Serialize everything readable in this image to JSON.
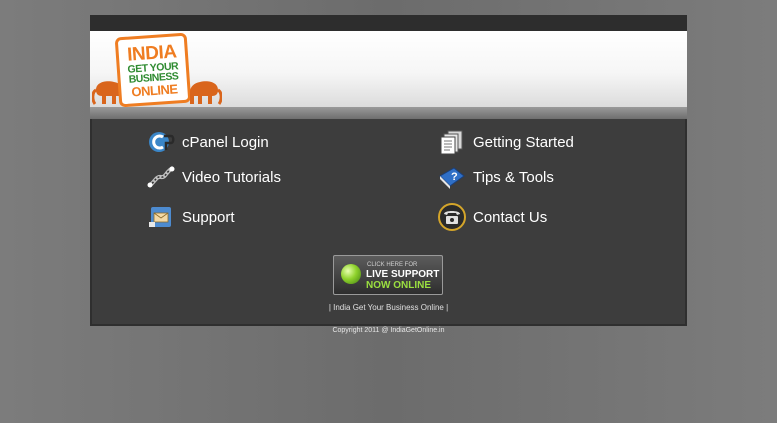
{
  "logo": {
    "line1": "INDIA",
    "line2": "GET YOUR",
    "line3": "BUSINESS",
    "line4": "ONLINE"
  },
  "menu": {
    "cpanel": {
      "label": "cPanel Login",
      "icon": "cpanel-icon"
    },
    "getting_started": {
      "label": "Getting Started",
      "icon": "documents-icon"
    },
    "video": {
      "label": "Video Tutorials",
      "icon": "film-reel-icon"
    },
    "tips": {
      "label": "Tips & Tools",
      "icon": "help-book-icon"
    },
    "support": {
      "label": "Support",
      "icon": "support-mail-icon"
    },
    "contact": {
      "label": "Contact Us",
      "icon": "telephone-icon"
    }
  },
  "live_support": {
    "small": "CLICK HERE FOR",
    "line1": "LIVE SUPPORT",
    "line2": "NOW ONLINE"
  },
  "footer": {
    "link_text": "| India Get Your Business Online |",
    "copyright": "Copyright 2011 @ IndiaGetOnline.in"
  },
  "colors": {
    "brand_orange": "#ef7d22",
    "brand_green": "#2f8b31",
    "panel_bg": "#3d3d3d"
  }
}
